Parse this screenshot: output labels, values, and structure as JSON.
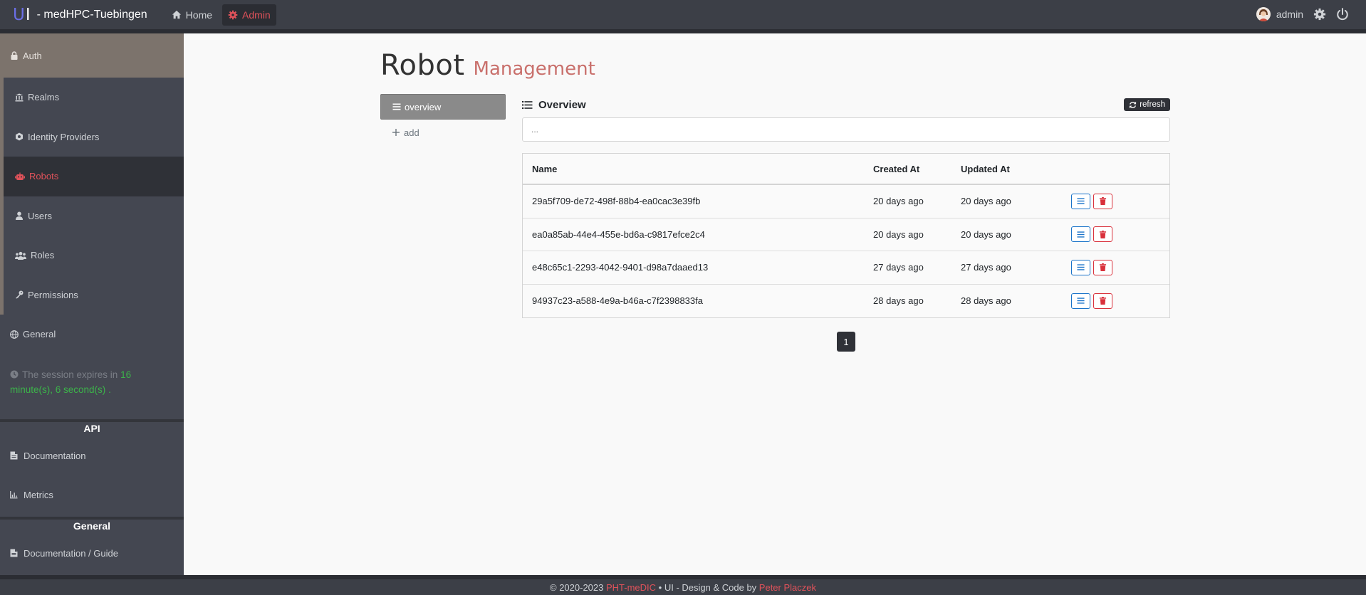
{
  "brand": {
    "logo": "U",
    "logo_bar": "I",
    "name": "- medHPC-Tuebingen"
  },
  "topnav": {
    "home": "Home",
    "admin": "Admin"
  },
  "user": {
    "name": "admin"
  },
  "sidebar": {
    "auth": "Auth",
    "items": [
      "Realms",
      "Identity Providers",
      "Robots",
      "Users",
      "Roles",
      "Permissions"
    ],
    "general_item": "General",
    "session": {
      "prefix": "The session expires in",
      "time": "16 minute(s), 6 second(s)",
      "suffix": "."
    },
    "api_header": "API",
    "api_items": [
      "Documentation",
      "Metrics"
    ],
    "general_header": "General",
    "general_items": [
      "Documentation / Guide"
    ]
  },
  "page": {
    "title": "Robot",
    "subtitle": "Management"
  },
  "subnav": {
    "overview": "overview",
    "add": "add"
  },
  "panel": {
    "title": "Overview",
    "refresh": "refresh",
    "search_placeholder": "..."
  },
  "table": {
    "headers": [
      "Name",
      "Created At",
      "Updated At"
    ],
    "rows": [
      [
        "29a5f709-de72-498f-88b4-ea0cac3e39fb",
        "20 days ago",
        "20 days ago"
      ],
      [
        "ea0a85ab-44e4-455e-bd6a-c9817efce2c4",
        "20 days ago",
        "20 days ago"
      ],
      [
        "e48c65c1-2293-4042-9401-d98a7daaed13",
        "27 days ago",
        "27 days ago"
      ],
      [
        "94937c23-a588-4e9a-b46a-c7f2398833fa",
        "28 days ago",
        "28 days ago"
      ]
    ]
  },
  "pagination": {
    "current": "1"
  },
  "footer": {
    "copy": "© 2020-2023",
    "project": "PHT-meDIC",
    "mid": "• UI - Design & Code by",
    "author": "Peter Placzek"
  },
  "colors": {
    "accent": "#e0525a",
    "topbar": "#3c3f47",
    "sidebar": "#444751",
    "auth_bg": "#7c736c",
    "session_green": "#3cb34a"
  },
  "icons": [
    "home-icon",
    "gear-icon",
    "settings-gear-icon",
    "power-icon",
    "lock-icon",
    "bank-icon",
    "hexagon-icon",
    "robot-icon",
    "user-icon",
    "users-icon",
    "key-icon",
    "globe-icon",
    "clock-icon",
    "file-icon",
    "chart-icon",
    "list-icon",
    "plus-icon",
    "refresh-icon",
    "bars-icon",
    "trash-icon"
  ]
}
